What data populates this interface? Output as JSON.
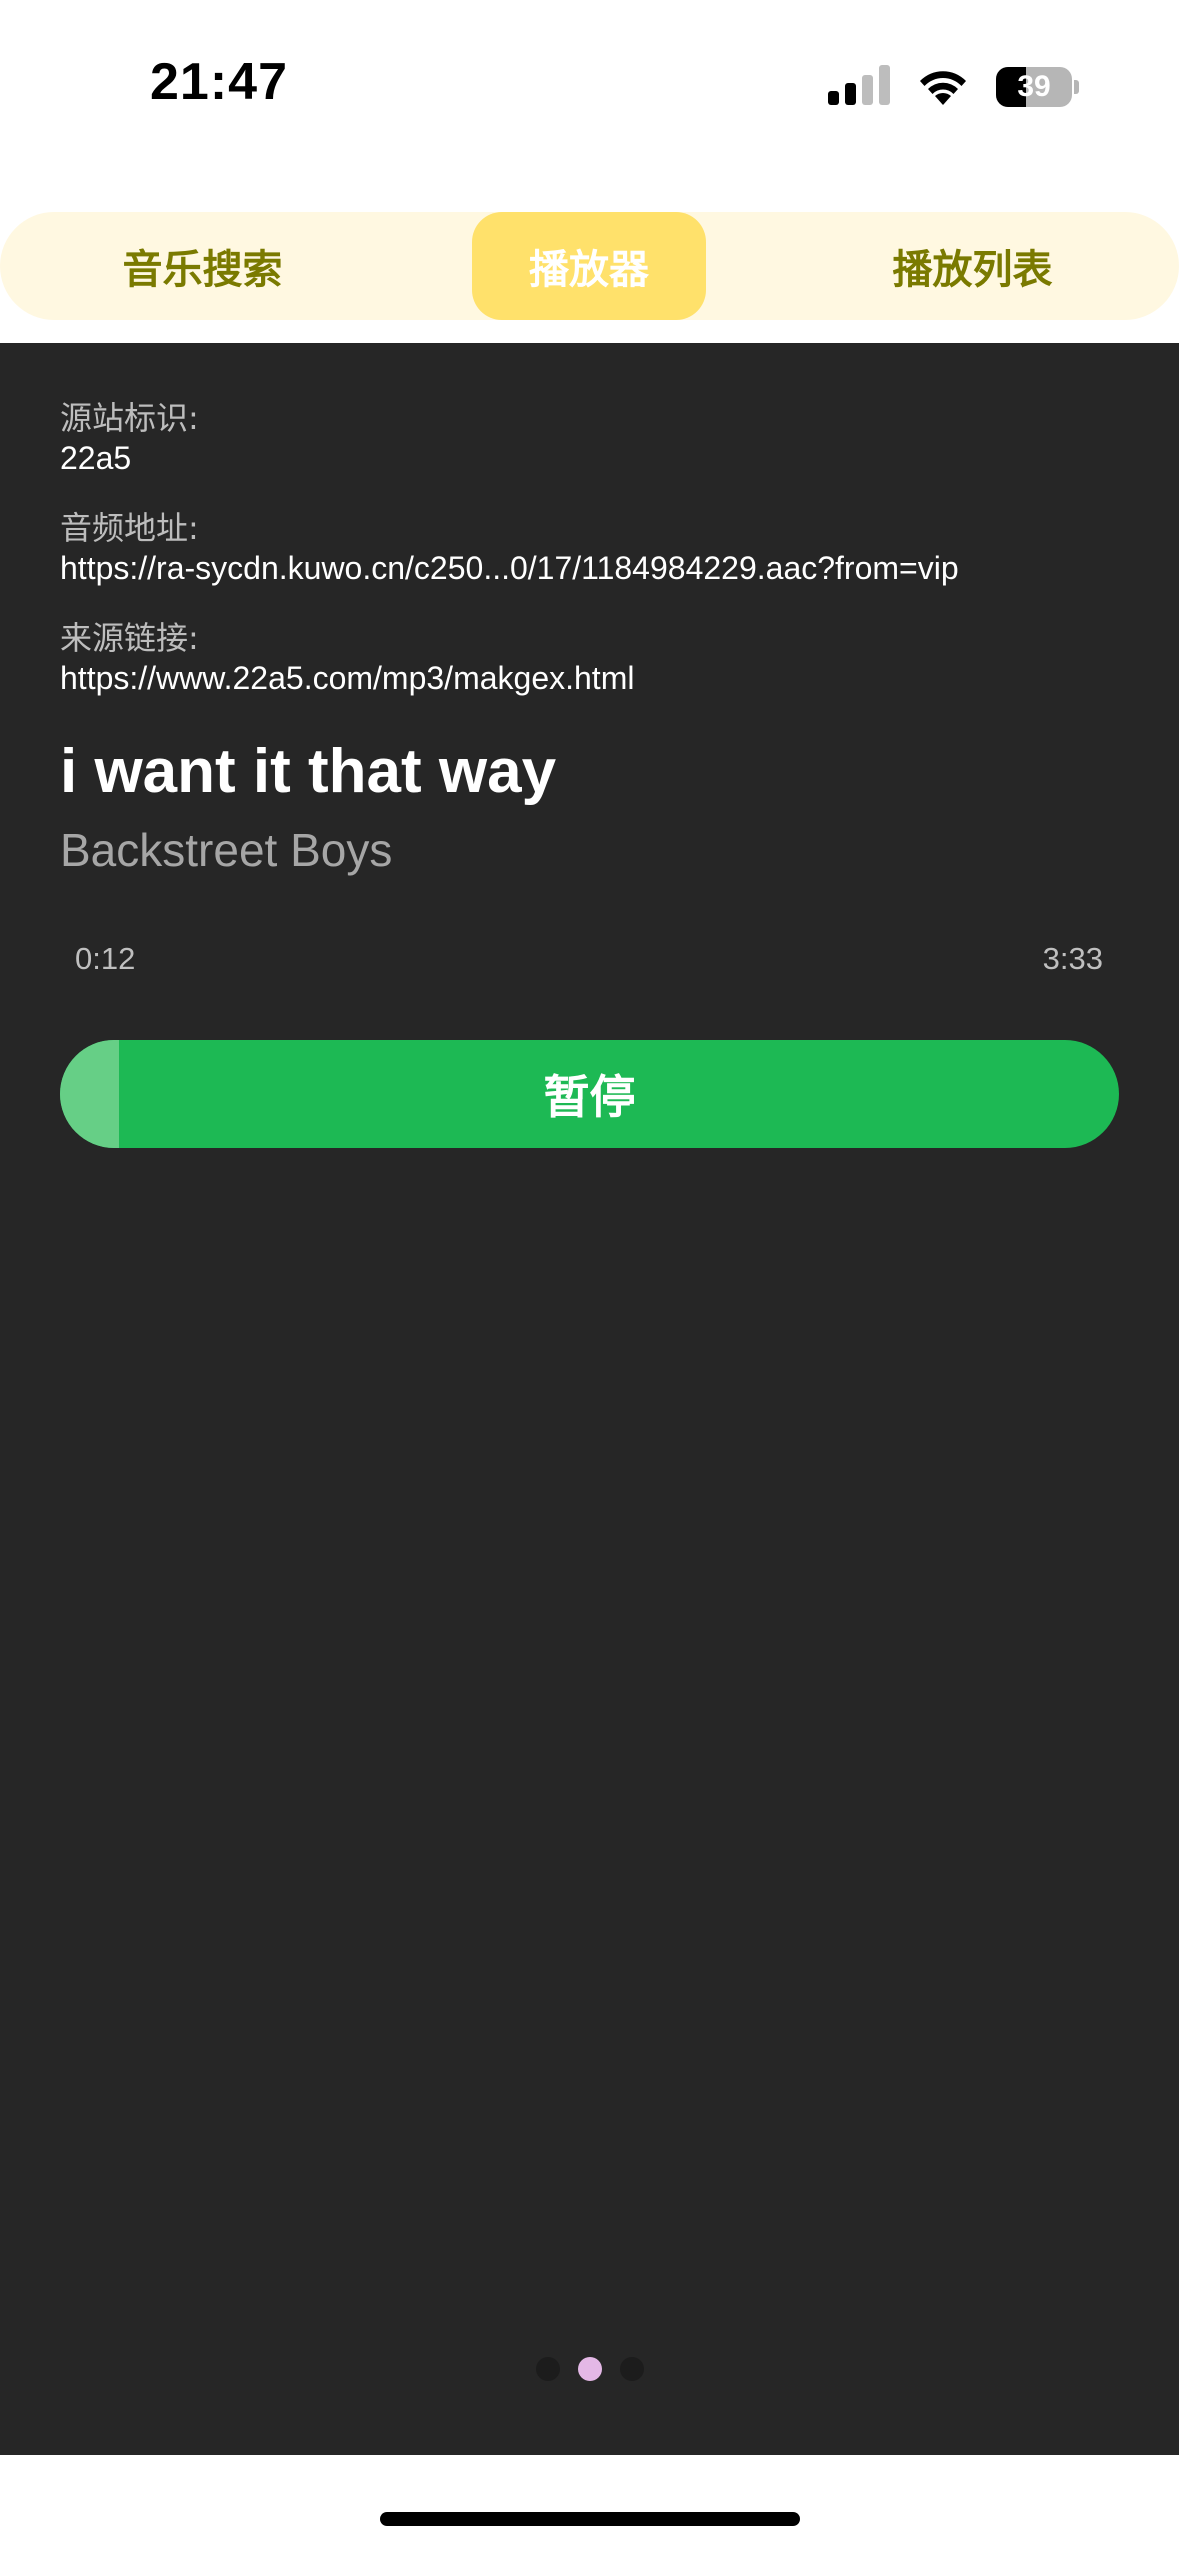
{
  "status_bar": {
    "time": "21:47",
    "battery_level": "39",
    "icons": [
      "cellular-signal-icon",
      "wifi-icon",
      "battery-icon"
    ]
  },
  "tabs": [
    {
      "label": "音乐搜索",
      "active": false
    },
    {
      "label": "播放器",
      "active": true
    },
    {
      "label": "播放列表",
      "active": false
    }
  ],
  "player": {
    "source_id_label": "源站标识:",
    "source_id_value": "22a5",
    "audio_url_label": "音频地址:",
    "audio_url_value": "https://ra-sycdn.kuwo.cn/c250...0/17/1184984229.aac?from=vip",
    "source_link_label": "来源链接:",
    "source_link_value": "https://www.22a5.com/mp3/makgex.html",
    "title": "i want it that way",
    "artist": "Backstreet Boys",
    "current_time": "0:12",
    "total_time": "3:33",
    "progress": 0.056,
    "pause_label": "暂停"
  },
  "pager": {
    "count": 3,
    "active_index": 1
  },
  "colors": {
    "tabbar_bg": "#fff8e1",
    "tab_active_bg": "#ffe16b",
    "tab_text": "#7a7a00",
    "panel_bg": "#262626",
    "play_button": "#1db954",
    "pager_active": "#e4b8e6"
  }
}
